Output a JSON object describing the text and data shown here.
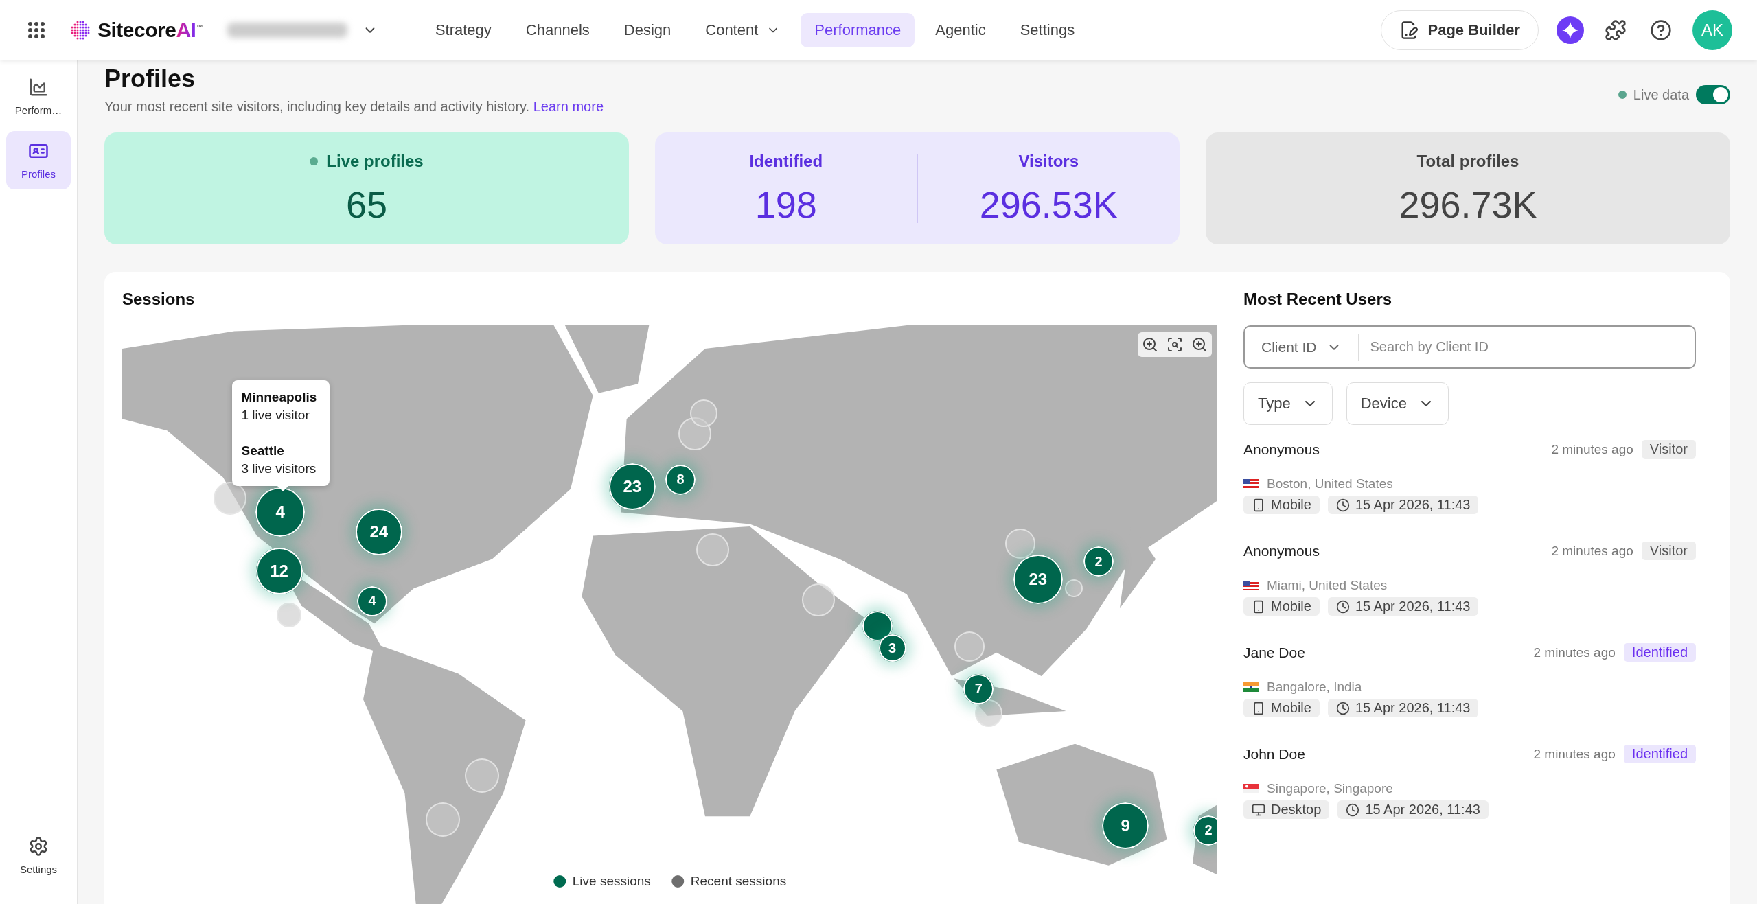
{
  "topbar": {
    "logo": {
      "name": "Sitecore",
      "suffix": "AI",
      "mark": "™"
    },
    "nav": [
      {
        "label": "Strategy",
        "selected": false,
        "has_menu": false
      },
      {
        "label": "Channels",
        "selected": false,
        "has_menu": false
      },
      {
        "label": "Design",
        "selected": false,
        "has_menu": false
      },
      {
        "label": "Content",
        "selected": false,
        "has_menu": true
      },
      {
        "label": "Performance",
        "selected": true,
        "has_menu": false
      },
      {
        "label": "Agentic",
        "selected": false,
        "has_menu": false
      },
      {
        "label": "Settings",
        "selected": false,
        "has_menu": false
      }
    ],
    "page_builder": "Page Builder",
    "avatar": "AK"
  },
  "sidebar": {
    "items": [
      {
        "label": "Perform…",
        "kind": "chart",
        "selected": false
      },
      {
        "label": "Profiles",
        "kind": "profile",
        "selected": true
      }
    ],
    "footer": "Settings"
  },
  "header": {
    "title": "Profiles",
    "description": "Your most recent site visitors, including key details and activity history.",
    "link": "Learn more",
    "live_data": {
      "label": "Live data",
      "on": true
    }
  },
  "stats": [
    {
      "kind": "live",
      "items": [
        {
          "label": "Live profiles",
          "value": "65"
        }
      ]
    },
    {
      "kind": "split",
      "items": [
        {
          "label": "Identified",
          "value": "198"
        },
        {
          "label": "Visitors",
          "value": "296.53K"
        }
      ]
    },
    {
      "kind": "total",
      "items": [
        {
          "label": "Total profiles",
          "value": "296.73K"
        }
      ]
    }
  ],
  "sessions": {
    "title": "Sessions",
    "markers": [
      {
        "kind": "recent"
      },
      {
        "kind": "recent"
      },
      {
        "kind": "recent"
      },
      {
        "kind": "recent"
      },
      {
        "kind": "recent"
      },
      {
        "kind": "recent"
      },
      {
        "kind": "recent"
      },
      {
        "kind": "recent"
      },
      {
        "kind": "recent"
      },
      {
        "kind": "recent"
      },
      {
        "kind": "recent"
      },
      {
        "kind": "recent"
      },
      {
        "kind": "live",
        "count": "4"
      },
      {
        "kind": "live",
        "count": "12"
      },
      {
        "kind": "live",
        "count": "24"
      },
      {
        "kind": "live",
        "count": "4"
      },
      {
        "kind": "live",
        "count": "23"
      },
      {
        "kind": "live",
        "count": "8"
      },
      {
        "kind": "live",
        "count": "23"
      },
      {
        "kind": "live",
        "count": "2"
      },
      {
        "kind": "live"
      },
      {
        "kind": "live",
        "count": "3"
      },
      {
        "kind": "live",
        "count": "7"
      },
      {
        "kind": "live",
        "count": "9"
      },
      {
        "kind": "live",
        "count": "2"
      }
    ],
    "tooltip": [
      {
        "city": "Minneapolis",
        "count": "1 live visitor"
      },
      {
        "city": "Seattle",
        "count": "3 live visitors"
      }
    ],
    "legend": [
      {
        "label": "Live sessions",
        "color": "#006b50"
      },
      {
        "label": "Recent sessions",
        "color": "#6e6e6e"
      }
    ]
  },
  "recent_users": {
    "title": "Most Recent Users",
    "search": {
      "scope": "Client ID",
      "placeholder": "Search by Client ID"
    },
    "filters": [
      "Type",
      "Device"
    ],
    "users": [
      {
        "name": "Anonymous",
        "time": "2 minutes ago",
        "type": "Visitor",
        "kind": "visitor",
        "location": {
          "kind": "us",
          "label": "Boston, United States"
        },
        "device": {
          "kind": "mobile",
          "label": "Mobile"
        },
        "date": "15 Apr 2026, 11:43"
      },
      {
        "name": "Anonymous",
        "time": "2 minutes ago",
        "type": "Visitor",
        "kind": "visitor",
        "location": {
          "kind": "us",
          "label": "Miami, United States"
        },
        "device": {
          "kind": "mobile",
          "label": "Mobile"
        },
        "date": "15 Apr 2026, 11:43"
      },
      {
        "name": "Jane Doe",
        "time": "2 minutes ago",
        "type": "Identified",
        "kind": "identified",
        "location": {
          "kind": "in",
          "label": "Bangalore, India"
        },
        "device": {
          "kind": "mobile",
          "label": "Mobile"
        },
        "date": "15 Apr 2026, 11:43"
      },
      {
        "name": "John Doe",
        "time": "2 minutes ago",
        "type": "Identified",
        "kind": "identified",
        "location": {
          "kind": "sg",
          "label": "Singapore, Singapore"
        },
        "device": {
          "kind": "desktop",
          "label": "Desktop"
        },
        "date": "15 Apr 2026, 11:43"
      }
    ]
  }
}
